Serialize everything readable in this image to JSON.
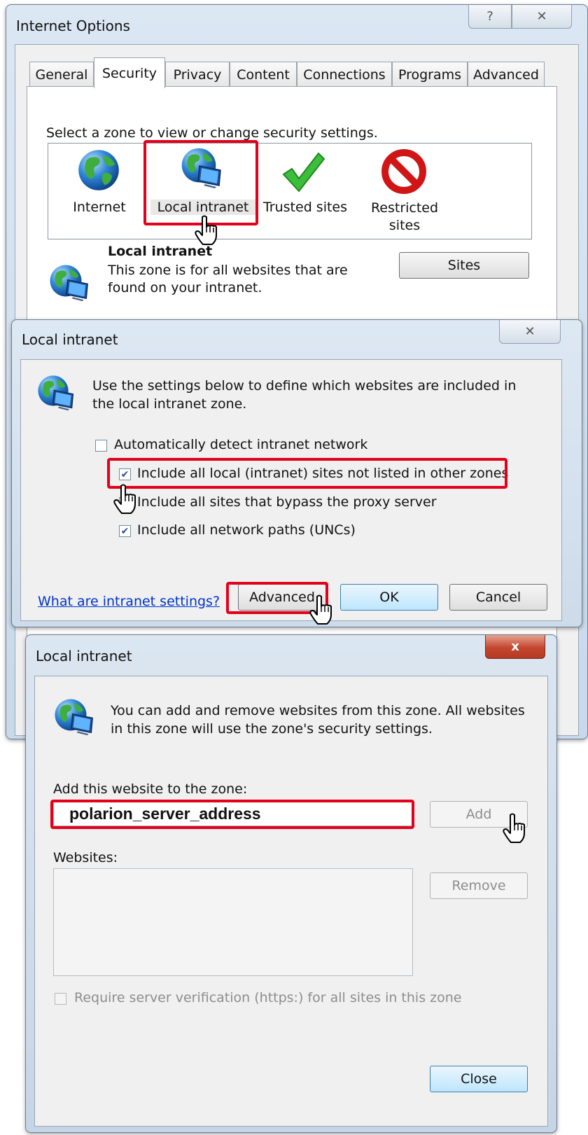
{
  "internet_options": {
    "title": "Internet Options",
    "help_glyph": "?",
    "close_glyph": "✕",
    "tabs": [
      "General",
      "Security",
      "Privacy",
      "Content",
      "Connections",
      "Programs",
      "Advanced"
    ],
    "active_tab": "Security",
    "zone_prompt": "Select a zone to view or change security settings.",
    "zones": [
      {
        "label": "Internet",
        "icon": "globe-icon"
      },
      {
        "label": "Local intranet",
        "icon": "globe-monitor-icon"
      },
      {
        "label": "Trusted sites",
        "icon": "checkmark-icon"
      },
      {
        "label": "Restricted sites",
        "icon": "restricted-icon"
      }
    ],
    "selected_zone": "Local intranet",
    "zone_heading": "Local intranet",
    "zone_description": "This zone is for all websites that are found on your intranet.",
    "sites_button": "Sites"
  },
  "local_intranet_1": {
    "title": "Local intranet",
    "close_glyph": "✕",
    "intro": "Use the settings below to define which websites are included in the local intranet zone.",
    "options": [
      {
        "label": "Automatically detect intranet network",
        "checked": false
      },
      {
        "label": "Include all local (intranet) sites not listed in other zones",
        "checked": true
      },
      {
        "label": "Include all sites that bypass the proxy server",
        "checked": false
      },
      {
        "label": "Include all network paths (UNCs)",
        "checked": true
      }
    ],
    "help_link": "What are intranet settings?",
    "advanced_button": "Advanced",
    "ok_button": "OK",
    "cancel_button": "Cancel"
  },
  "local_intranet_2": {
    "title": "Local intranet",
    "close_glyph": "x",
    "intro": "You can add and remove websites from this zone. All websites in this zone will use the zone's security settings.",
    "add_label": "Add this website to the zone:",
    "add_value": "polarion_server_address",
    "add_button": "Add",
    "websites_label": "Websites:",
    "remove_button": "Remove",
    "require_https_label": "Require server verification (https:) for all sites in this zone",
    "require_https_checked": false,
    "close_button": "Close"
  },
  "colors": {
    "highlight": "#e4001b",
    "link": "#0033cc"
  }
}
